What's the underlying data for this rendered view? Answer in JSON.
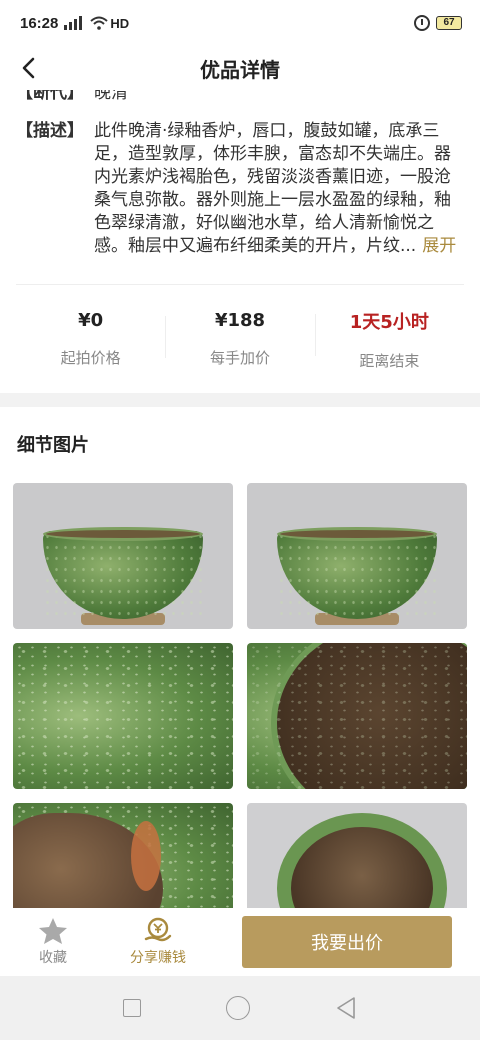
{
  "status": {
    "time": "16:28",
    "network": "HD",
    "battery": "67"
  },
  "header": {
    "title": "优品详情"
  },
  "item": {
    "era_label": "【断代】",
    "era_value": "晚清",
    "desc_label": "【描述】",
    "desc_text": "此件晚清·绿釉香炉，唇口，腹鼓如罐，底承三足，造型敦厚，体形丰腴，富态却不失端庄。器内光素炉浅褐胎色，残留淡淡香薰旧迹，一股沧桑气息弥散。器外则施上一层水盈盈的绿釉，釉色翠绿清澈，好似幽池水草，给人清新愉悦之感。釉层中又遍布纤细柔美的开片，片纹...",
    "more_label": "展开"
  },
  "stats": [
    {
      "value": "¥0",
      "caption": "起拍价格"
    },
    {
      "value": "¥188",
      "caption": "每手加价"
    },
    {
      "value": "1天5小时",
      "caption": "距离结束"
    }
  ],
  "details": {
    "title": "细节图片"
  },
  "bottom": {
    "favorite": "收藏",
    "share": "分享赚钱",
    "bid": "我要出价"
  },
  "colors": {
    "accent": "#b89b5e",
    "gold_text": "#a98a3e",
    "countdown_red": "#b82222"
  },
  "icons": [
    "back-arrow-icon",
    "star-icon",
    "share-money-icon",
    "alarm-icon",
    "wifi-icon"
  ]
}
